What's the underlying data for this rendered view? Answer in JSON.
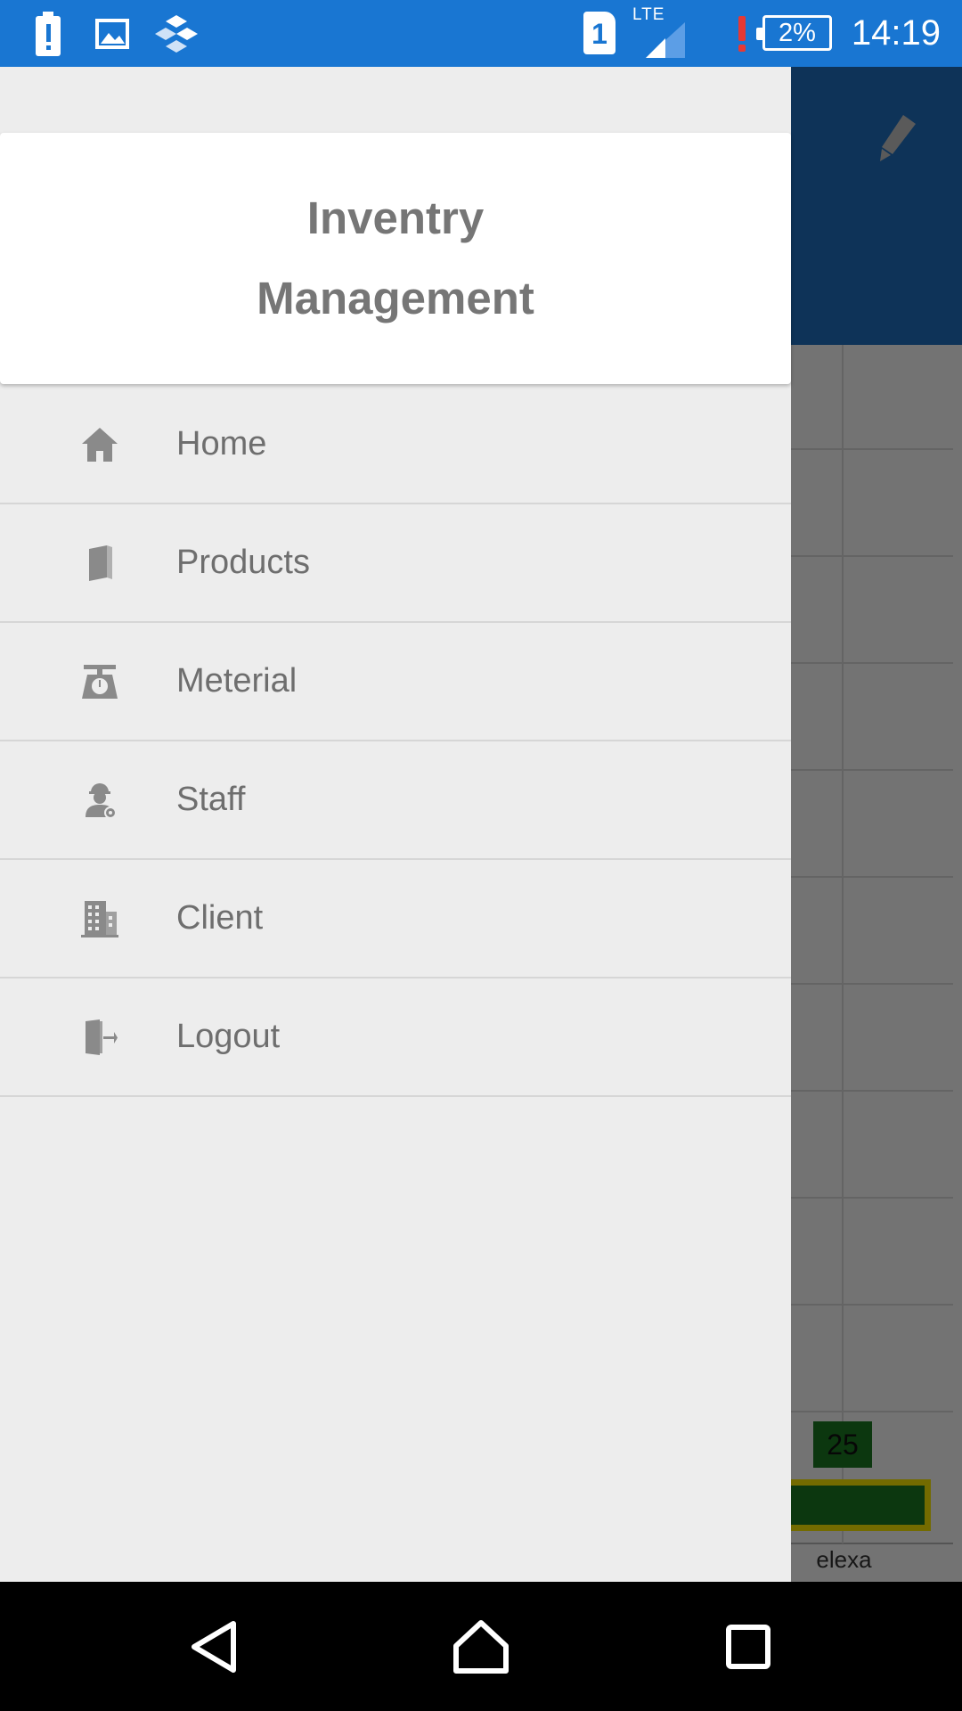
{
  "status_bar": {
    "sim_slot": "1",
    "network": "LTE",
    "battery": "2%",
    "time": "14:19",
    "icons": [
      "battery-alert-icon",
      "gallery-icon",
      "app-cubes-icon",
      "sim-icon",
      "signal-icon",
      "alert-icon"
    ]
  },
  "drawer": {
    "title_line1": "Inventry",
    "title_line2": "Management",
    "items": [
      {
        "label": "Home",
        "icon": "home-icon"
      },
      {
        "label": "Products",
        "icon": "product-box-icon"
      },
      {
        "label": "Meterial",
        "icon": "weighing-scale-icon"
      },
      {
        "label": "Staff",
        "icon": "staff-worker-icon"
      },
      {
        "label": "Client",
        "icon": "building-icon"
      },
      {
        "label": "Logout",
        "icon": "logout-door-icon"
      }
    ]
  },
  "background_app": {
    "toolbar_action_icon": "edit-pencil-icon",
    "chart_data": {
      "type": "bar",
      "categories": [
        "elexa"
      ],
      "values": [
        25
      ],
      "data_labels": [
        "25"
      ]
    }
  },
  "colors": {
    "status_bar": "#1976d2",
    "drawer_bg": "#ededed",
    "text_gray": "#6e6e6e",
    "bar_fill": "#1b7a22",
    "bar_border": "#ffee00"
  },
  "nav_bar": {
    "buttons": [
      "back-icon",
      "home-icon",
      "recents-icon"
    ]
  }
}
